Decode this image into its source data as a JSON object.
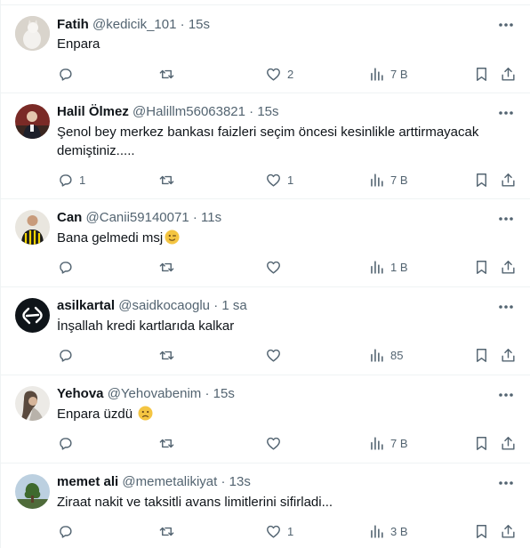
{
  "tweets": [
    {
      "name": "Fatih",
      "handle": "@kedicik_101",
      "dot": "·",
      "time": "15s",
      "text": "Enpara",
      "emoji": "",
      "reply_count": "",
      "like_count": "2",
      "views": "7 B"
    },
    {
      "name": "Halil Ölmez",
      "handle": "@Halillm56063821",
      "dot": "·",
      "time": "15s",
      "text": "Şenol bey merkez bankası faizleri seçim öncesi kesinlikle arttirmayacak demiştiniz.....",
      "emoji": "",
      "reply_count": "1",
      "like_count": "1",
      "views": "7 B"
    },
    {
      "name": "Can",
      "handle": "@Canii59140071",
      "dot": "·",
      "time": "11s",
      "text": "Bana gelmedi msj",
      "emoji": "wink",
      "reply_count": "",
      "like_count": "",
      "views": "1 B"
    },
    {
      "name": "asilkartal",
      "handle": "@saidkocaoglu",
      "dot": "·",
      "time": "1 sa",
      "text": "İnşallah kredi kartlarıda kalkar",
      "emoji": "",
      "reply_count": "",
      "like_count": "",
      "views": "85"
    },
    {
      "name": "Yehova",
      "handle": "@Yehovabenim",
      "dot": "·",
      "time": "15s",
      "text": "Enpara üzdü",
      "emoji": "frown",
      "reply_count": "",
      "like_count": "",
      "views": "7 B"
    },
    {
      "name": "memet ali",
      "handle": "@memetalikiyat",
      "dot": "·",
      "time": "13s",
      "text": "Ziraat nakit ve taksitli avans limitlerini sifirladi...",
      "emoji": "",
      "reply_count": "",
      "like_count": "1",
      "views": "3 B"
    }
  ],
  "colors": {
    "text": "#0f1419",
    "secondary": "#536471",
    "divider": "#eff3f4"
  },
  "icons": [
    "more-icon",
    "reply-icon",
    "retweet-icon",
    "like-icon",
    "views-icon",
    "bookmark-icon",
    "share-icon"
  ]
}
